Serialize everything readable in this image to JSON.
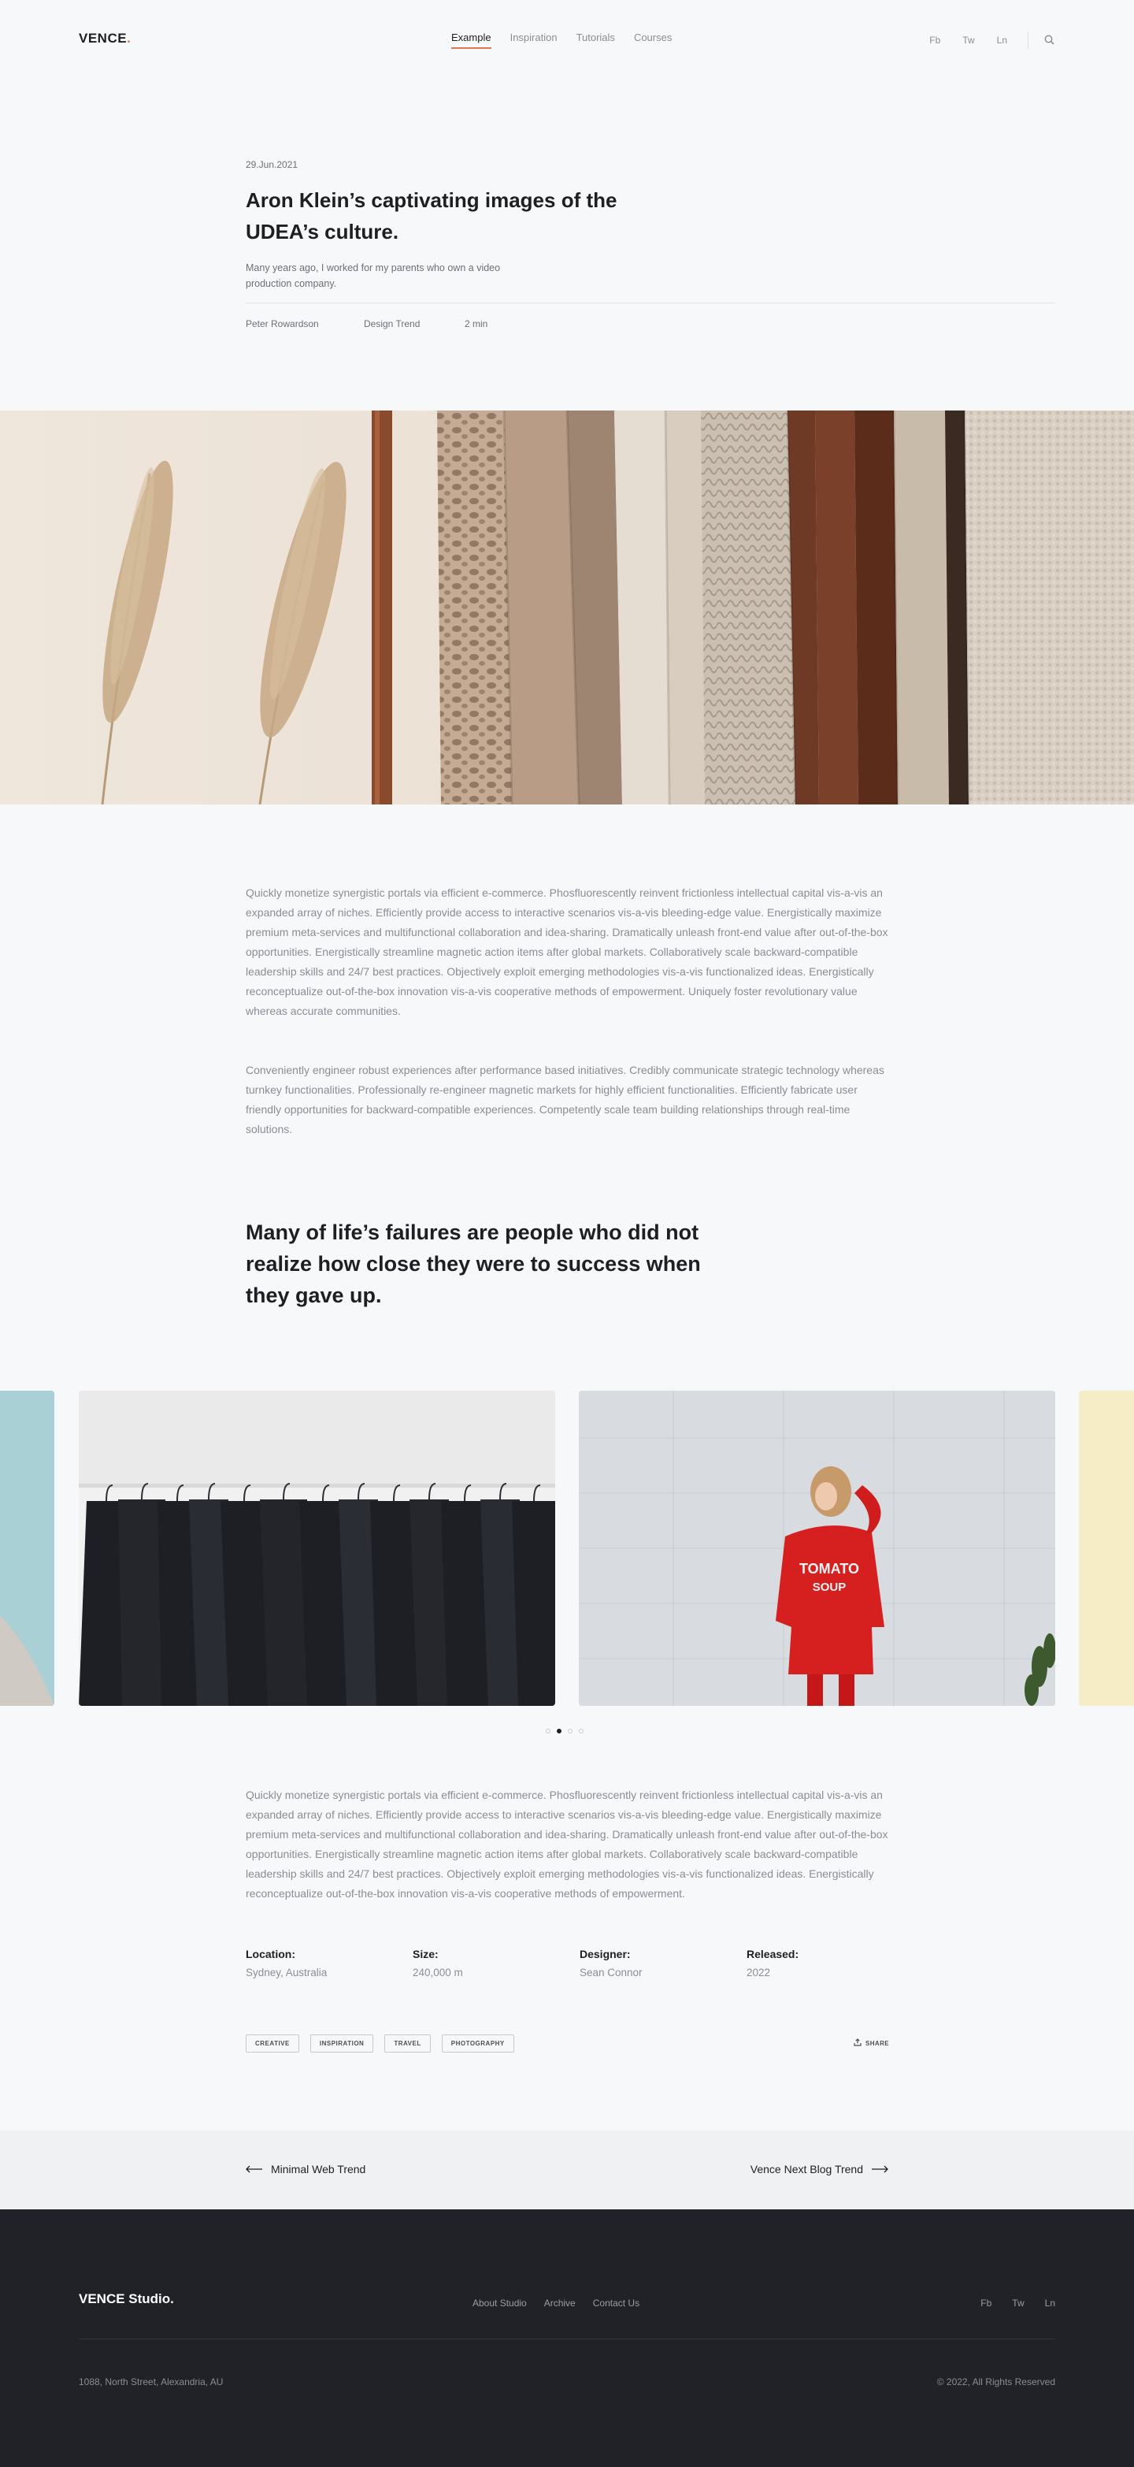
{
  "header": {
    "logo": "VENCE",
    "logo_dot": ".",
    "nav": [
      "Example",
      "Inspiration",
      "Tutorials",
      "Courses"
    ],
    "social": [
      "Fb",
      "Tw",
      "Ln"
    ]
  },
  "article": {
    "date": "29.Jun.2021",
    "title": "Aron Klein’s captivating images of the UDEA’s culture.",
    "subtitle": "Many years ago, I worked for my parents who own a video production company.",
    "author": "Peter Rowardson",
    "category": "Design Trend",
    "read_time": "2 min",
    "paragraph_1": "Quickly monetize synergistic portals via efficient e-commerce. Phosfluorescently reinvent frictionless intellectual capital vis-a-vis an expanded array of niches. Efficiently provide access to interactive scenarios vis-a-vis bleeding-edge value. Energistically maximize premium meta-services and multifunctional collaboration and idea-sharing. Dramatically unleash front-end value after out-of-the-box opportunities. Energistically streamline magnetic action items after global markets. Collaboratively scale backward-compatible leadership skills and 24/7 best practices. Objectively exploit emerging methodologies vis-a-vis functionalized ideas. Energistically reconceptualize out-of-the-box innovation vis-a-vis cooperative methods of empowerment. Uniquely foster revolutionary value whereas accurate communities.",
    "paragraph_2": "Conveniently engineer robust experiences after performance based initiatives. Credibly communicate strategic technology whereas turnkey functionalities. Professionally re-engineer magnetic markets for highly efficient functionalities. Efficiently fabricate user friendly opportunities for backward-compatible experiences. Competently scale team building relationships through real-time solutions.",
    "quote": "Many of life’s failures are people who did not realize how close they were to success when they gave up.",
    "paragraph_3": "Quickly monetize synergistic portals via efficient e-commerce. Phosfluorescently reinvent frictionless intellectual capital vis-a-vis an expanded array of niches. Efficiently provide access to interactive scenarios vis-a-vis bleeding-edge value. Energistically maximize premium meta-services and multifunctional collaboration and idea-sharing. Dramatically unleash front-end value after out-of-the-box opportunities. Energistically streamline magnetic action items after global markets. Collaboratively scale backward-compatible leadership skills and 24/7 best practices. Objectively exploit emerging methodologies vis-a-vis functionalized ideas. Energistically reconceptualize out-of-the-box innovation vis-a-vis cooperative methods of empowerment."
  },
  "gallery": {
    "active_dot": 2,
    "dot_count": 4,
    "sweater_text_1": "TOMATO",
    "sweater_text_2": "SOUP"
  },
  "info": [
    {
      "label": "Location:",
      "value": "Sydney, Australia"
    },
    {
      "label": "Size:",
      "value": "240,000 m"
    },
    {
      "label": "Designer:",
      "value": "Sean Connor"
    },
    {
      "label": "Released:",
      "value": "2022"
    }
  ],
  "tags": [
    "CREATIVE",
    "INSPIRATION",
    "TRAVEL",
    "PHOTOGRAPHY"
  ],
  "share_label": "SHARE",
  "post_nav": {
    "prev": "Minimal Web Trend",
    "next": "Vence Next Blog Trend"
  },
  "footer": {
    "logo": "VENCE Studio.",
    "links": [
      "About Studio",
      "Archive",
      "Contact Us"
    ],
    "social": [
      "Fb",
      "Tw",
      "Ln"
    ],
    "address": "1088, North Street, Alexandria, AU",
    "copyright": "© 2022, All Rights Reserved"
  },
  "colors": {
    "accent": "#e0774f",
    "background": "#f7f8fa",
    "footer_bg": "#202228",
    "text_dark": "#1e1f23",
    "text_muted": "#8a8d94"
  }
}
